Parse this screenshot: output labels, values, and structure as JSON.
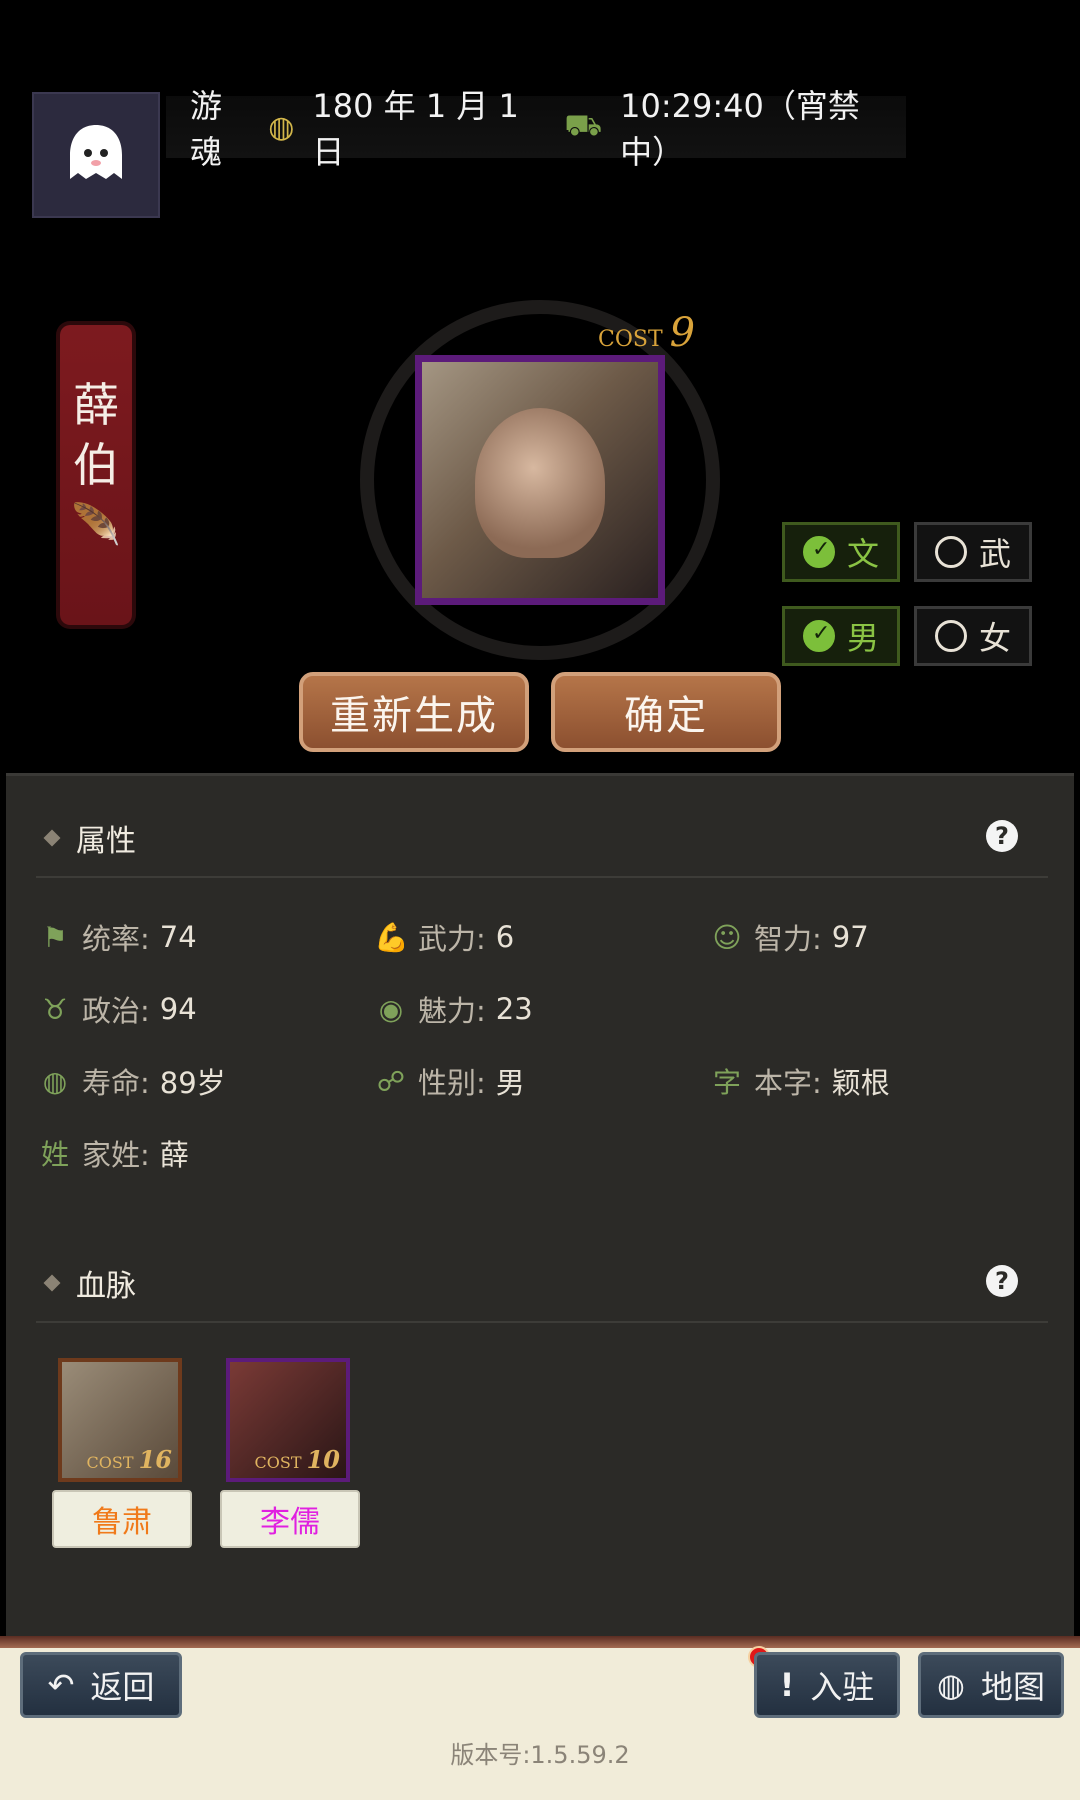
{
  "header": {
    "player_name": "游魂",
    "date": "180 年 1 月 1 日",
    "time": "10:29:40（宵禁中）"
  },
  "character": {
    "name_chars": [
      "薛",
      "伯"
    ],
    "cost_label": "COST",
    "cost_value": "9"
  },
  "toggles": {
    "wen": "文",
    "wu": "武",
    "male": "男",
    "female": "女"
  },
  "actions": {
    "regenerate": "重新生成",
    "confirm": "确定"
  },
  "attributes": {
    "title": "属性",
    "help": "?",
    "stats": [
      {
        "label": "统率:",
        "value": "74",
        "icon": "flag-icon"
      },
      {
        "label": "武力:",
        "value": "6",
        "icon": "arm-icon"
      },
      {
        "label": "智力:",
        "value": "97",
        "icon": "brain-icon"
      },
      {
        "label": "政治:",
        "value": "94",
        "icon": "bag-icon"
      },
      {
        "label": "魅力:",
        "value": "23",
        "icon": "eye-icon"
      },
      {
        "label": "寿命:",
        "value": "89岁",
        "icon": "lifespan-icon"
      },
      {
        "label": "性别:",
        "value": "男",
        "icon": "gender-icon"
      },
      {
        "label": "本字:",
        "value": "颖根",
        "icon": "zi-icon",
        "glyph": "字"
      },
      {
        "label": "家姓:",
        "value": "薛",
        "icon": "xing-icon",
        "glyph": "姓"
      }
    ]
  },
  "bloodline": {
    "title": "血脉",
    "help": "?",
    "members": [
      {
        "name": "鲁肃",
        "cost_label": "COST",
        "cost": "16",
        "name_color": "#f07a1a"
      },
      {
        "name": "李儒",
        "cost_label": "COST",
        "cost": "10",
        "name_color": "#e020e0"
      }
    ]
  },
  "footer": {
    "back": "返回",
    "station": "入驻",
    "map": "地图",
    "version": "版本号:1.5.59.2"
  },
  "colors": {
    "panel": "#2b2a27",
    "accent_green": "#7cbf3a",
    "button_brown": "#a9673f",
    "nav_blue": "#2c3a4a"
  }
}
